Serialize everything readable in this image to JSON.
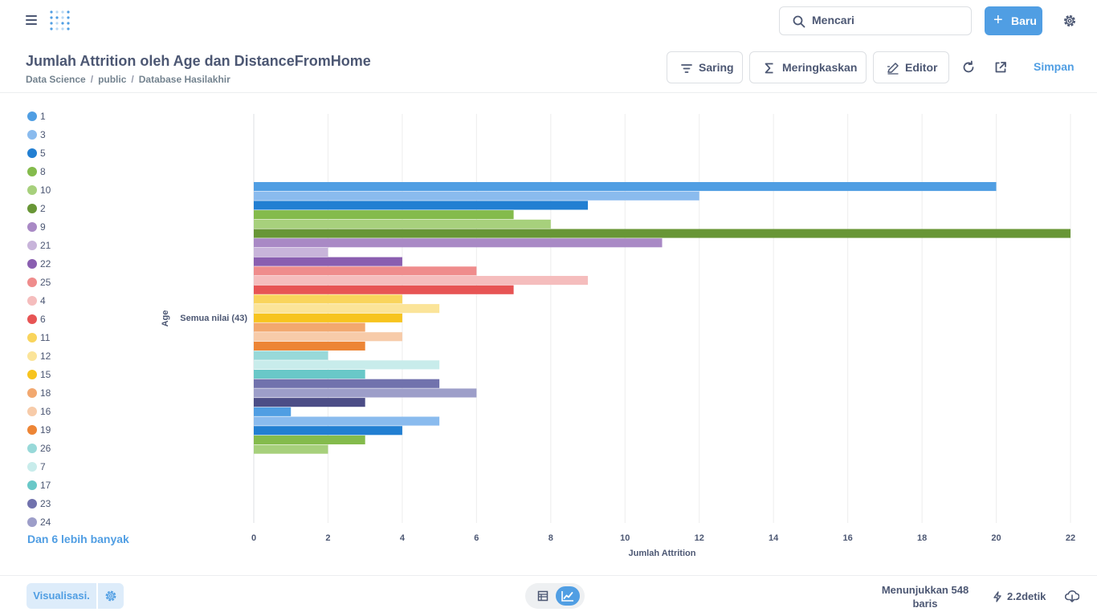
{
  "nav": {
    "search_placeholder": "Mencari",
    "new_button": "Baru"
  },
  "header": {
    "title": "Jumlah Attrition oleh Age dan DistanceFromHome",
    "breadcrumb": [
      "Data Science",
      "public",
      "Database Hasilakhir"
    ],
    "filter_button": "Saring",
    "summarize_button": "Meringkaskan",
    "editor_button": "Editor",
    "save_link": "Simpan"
  },
  "legend": {
    "more_label": "Dan 6 lebih banyak"
  },
  "chart_data": {
    "type": "bar",
    "orientation": "horizontal",
    "xlabel": "Jumlah Attrition",
    "ylabel": "Age",
    "category": "Semua nilai (43)",
    "xlim": [
      0,
      22
    ],
    "xticks": [
      0,
      2,
      4,
      6,
      8,
      10,
      12,
      14,
      16,
      18,
      20,
      22
    ],
    "grid": true,
    "legend_position": "left",
    "series": [
      {
        "name": "1",
        "value": 20,
        "color": "#509ee3"
      },
      {
        "name": "3",
        "value": 12,
        "color": "#8abbee"
      },
      {
        "name": "5",
        "value": 9,
        "color": "#227fd2"
      },
      {
        "name": "8",
        "value": 7,
        "color": "#84bb4c"
      },
      {
        "name": "10",
        "value": 8,
        "color": "#a7d07c"
      },
      {
        "name": "2",
        "value": 22,
        "color": "#689636"
      },
      {
        "name": "9",
        "value": 11,
        "color": "#a989c5"
      },
      {
        "name": "21",
        "value": 2,
        "color": "#c8b4da"
      },
      {
        "name": "22",
        "value": 4,
        "color": "#8a5eb0"
      },
      {
        "name": "25",
        "value": 6,
        "color": "#ef8c8c"
      },
      {
        "name": "4",
        "value": 9,
        "color": "#f5bdbd"
      },
      {
        "name": "6",
        "value": 7,
        "color": "#e75454"
      },
      {
        "name": "11",
        "value": 4,
        "color": "#f9d45c"
      },
      {
        "name": "12",
        "value": 5,
        "color": "#fbe499"
      },
      {
        "name": "15",
        "value": 4,
        "color": "#f7c41f"
      },
      {
        "name": "18",
        "value": 3,
        "color": "#f2a86f"
      },
      {
        "name": "16",
        "value": 4,
        "color": "#f7cba9"
      },
      {
        "name": "19",
        "value": 3,
        "color": "#ed8535"
      },
      {
        "name": "26",
        "value": 2,
        "color": "#98d9d9"
      },
      {
        "name": "7",
        "value": 5,
        "color": "#c8eceb"
      },
      {
        "name": "17",
        "value": 3,
        "color": "#69c8c8"
      },
      {
        "name": "23",
        "value": 5,
        "color": "#7172ad"
      },
      {
        "name": "24",
        "value": 6,
        "color": "#9d9ec9"
      },
      {
        "name": "",
        "value": 3,
        "color": "#4c4d86"
      },
      {
        "name": "",
        "value": 1,
        "color": "#509ee3"
      },
      {
        "name": "",
        "value": 5,
        "color": "#8abbee"
      },
      {
        "name": "",
        "value": 4,
        "color": "#227fd2"
      },
      {
        "name": "",
        "value": 3,
        "color": "#84bb4c"
      },
      {
        "name": "",
        "value": 2,
        "color": "#a7d07c"
      }
    ]
  },
  "footer": {
    "visualization_button": "Visualisasi.",
    "rows_label": "Menunjukkan 548 baris",
    "timing": "2.2detik"
  },
  "colors": {
    "accent": "#509ee3",
    "text": "#4c5773",
    "border": "#dcdfe3"
  }
}
